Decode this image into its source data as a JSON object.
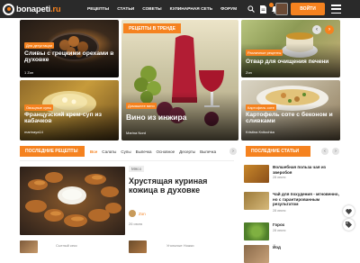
{
  "header": {
    "logo": {
      "name": "bonapeti",
      "tld": ".ru"
    },
    "nav": [
      "РЕЦЕПТЫ",
      "СТАТЬИ",
      "СОВЕТЫ",
      "КУЛИНАРНАЯ СЕТЬ",
      "ФОРУМ"
    ],
    "login_label": "ВОЙТИ",
    "icons": [
      "search-icon",
      "document-icon",
      "bell-icon",
      "avatar",
      "menu-icon"
    ],
    "accent": "#f5821f"
  },
  "hero": {
    "trend_label": "РЕЦЕПТЫ В ТРЕНДЕ",
    "cards": [
      {
        "category": "Для дегустации",
        "title": "Сливы с грецкими орехами в духовке",
        "meta": "1   Zon"
      },
      {
        "category": "",
        "title": "Вино из инжира",
        "author": "Marina Nord"
      },
      {
        "category": "Различные рецепты",
        "title": "Отвар для очищения печени",
        "meta": "Zon"
      },
      {
        "category": "Овощные супы",
        "title": "Французский крем-суп из кабачков",
        "author": "marinaya14"
      },
      {
        "category": "Домашнее вино",
        "title": "",
        "author": ""
      },
      {
        "category": "Картофель соте",
        "title": "Картофель соте с беконом и сливками",
        "author": "Kristina Kvitochka"
      }
    ]
  },
  "latest": {
    "heading": "ПОСЛЕДНИЕ РЕЦЕПТЫ",
    "tabs": [
      "Все",
      "Салаты",
      "Супы",
      "Выпечка",
      "Основное",
      "Десерты",
      "Выпечка"
    ],
    "featured": {
      "tag": "Мясо",
      "title": "Хрустящая куриная кожица в духовке",
      "author": "Zon",
      "date": "26 июля"
    },
    "more": [
      {
        "category": "Сытный кекс"
      },
      {
        "category": "Угольные Ножки"
      }
    ]
  },
  "articles": {
    "heading": "ПОСЛЕДНИЕ СТАТЬИ",
    "items": [
      {
        "title": "Волшебная польза чая из зверобоя",
        "date": "28 июля"
      },
      {
        "title": "Чай для похудения - мгновенно, но с гарантированным результатом",
        "date": "28 июля"
      },
      {
        "title": "Горох",
        "date": "28 июля"
      },
      {
        "title": "Йод",
        "date": ""
      }
    ]
  },
  "floating": {
    "icons": [
      "heart-icon",
      "tag-icon"
    ]
  }
}
